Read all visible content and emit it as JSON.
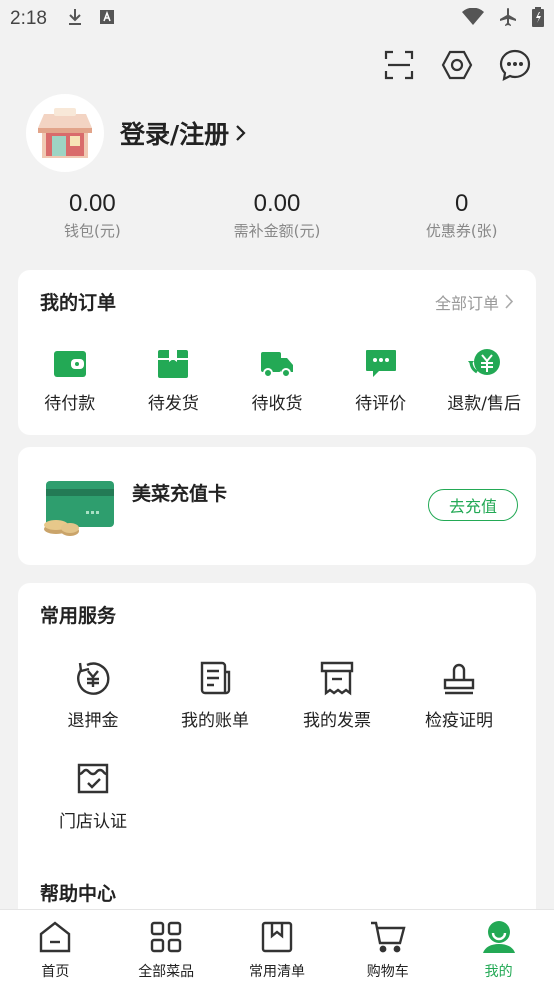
{
  "status_bar": {
    "time": "2:18"
  },
  "profile": {
    "login_label": "登录/注册"
  },
  "stats": [
    {
      "value": "0.00",
      "label": "钱包(元)"
    },
    {
      "value": "0.00",
      "label": "需补金额(元)"
    },
    {
      "value": "0",
      "label": "优惠券(张)"
    }
  ],
  "orders": {
    "title": "我的订单",
    "more_label": "全部订单",
    "items": [
      {
        "label": "待付款",
        "icon": "wallet-icon"
      },
      {
        "label": "待发货",
        "icon": "package-icon"
      },
      {
        "label": "待收货",
        "icon": "truck-icon"
      },
      {
        "label": "待评价",
        "icon": "comment-icon"
      },
      {
        "label": "退款/售后",
        "icon": "refund-icon"
      }
    ]
  },
  "recharge": {
    "title": "美菜充值卡",
    "button_label": "去充值"
  },
  "services": {
    "title": "常用服务",
    "items": [
      {
        "label": "退押金",
        "icon": "deposit-refund-icon"
      },
      {
        "label": "我的账单",
        "icon": "bill-icon"
      },
      {
        "label": "我的发票",
        "icon": "invoice-icon"
      },
      {
        "label": "检疫证明",
        "icon": "stamp-icon"
      },
      {
        "label": "门店认证",
        "icon": "store-verify-icon"
      }
    ]
  },
  "help": {
    "title": "帮助中心"
  },
  "bottom_nav": [
    {
      "label": "首页",
      "icon": "home-icon"
    },
    {
      "label": "全部菜品",
      "icon": "grid-icon"
    },
    {
      "label": "常用清单",
      "icon": "bookmark-icon"
    },
    {
      "label": "购物车",
      "icon": "cart-icon"
    },
    {
      "label": "我的",
      "icon": "profile-icon",
      "active": true
    }
  ],
  "colors": {
    "accent": "#23a955",
    "background": "#f2f2f2",
    "text": "#222222",
    "muted": "#888888"
  }
}
